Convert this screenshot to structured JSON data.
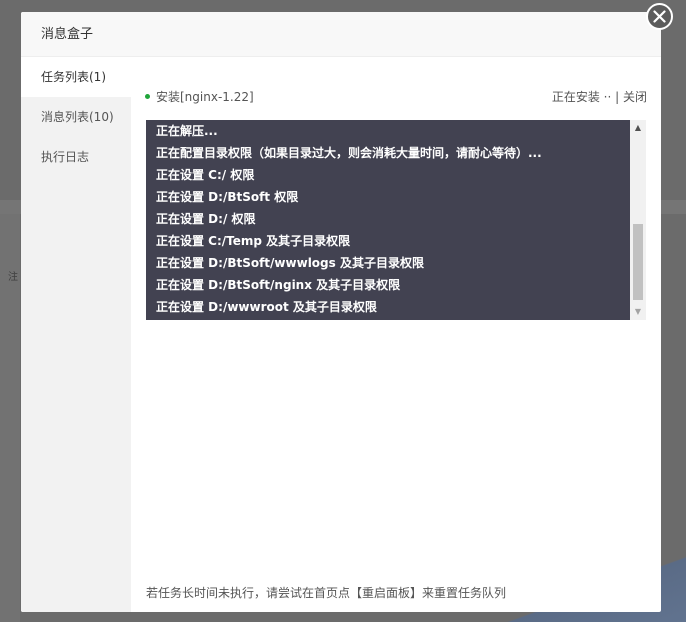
{
  "modal": {
    "title": "消息盒子",
    "close_icon": "close-icon"
  },
  "sidebar": {
    "items": [
      {
        "label": "任务列表(1)",
        "active": true
      },
      {
        "label": "消息列表(10)",
        "active": false
      },
      {
        "label": "执行日志",
        "active": false
      }
    ]
  },
  "task": {
    "name": "安装[nginx-1.22]",
    "status": "正在安装 ··",
    "close_label": "| 关闭",
    "status_color": "#20a53a"
  },
  "log": {
    "lines": [
      "正在解压...",
      "正在配置目录权限（如果目录过大，则会消耗大量时间，请耐心等待）...",
      "正在设置 C:/ 权限",
      "正在设置 D:/BtSoft 权限",
      "正在设置 D:/ 权限",
      "正在设置 C:/Temp 及其子目录权限",
      "正在设置 D:/BtSoft/wwwlogs 及其子目录权限",
      "正在设置 D:/BtSoft/nginx 及其子目录权限",
      "正在设置 D:/wwwroot 及其子目录权限"
    ],
    "background_color": "#424251"
  },
  "hint": "若任务长时间未执行，请尝试在首页点【重启面板】来重置任务队列",
  "background": {
    "partial_text": "注"
  }
}
